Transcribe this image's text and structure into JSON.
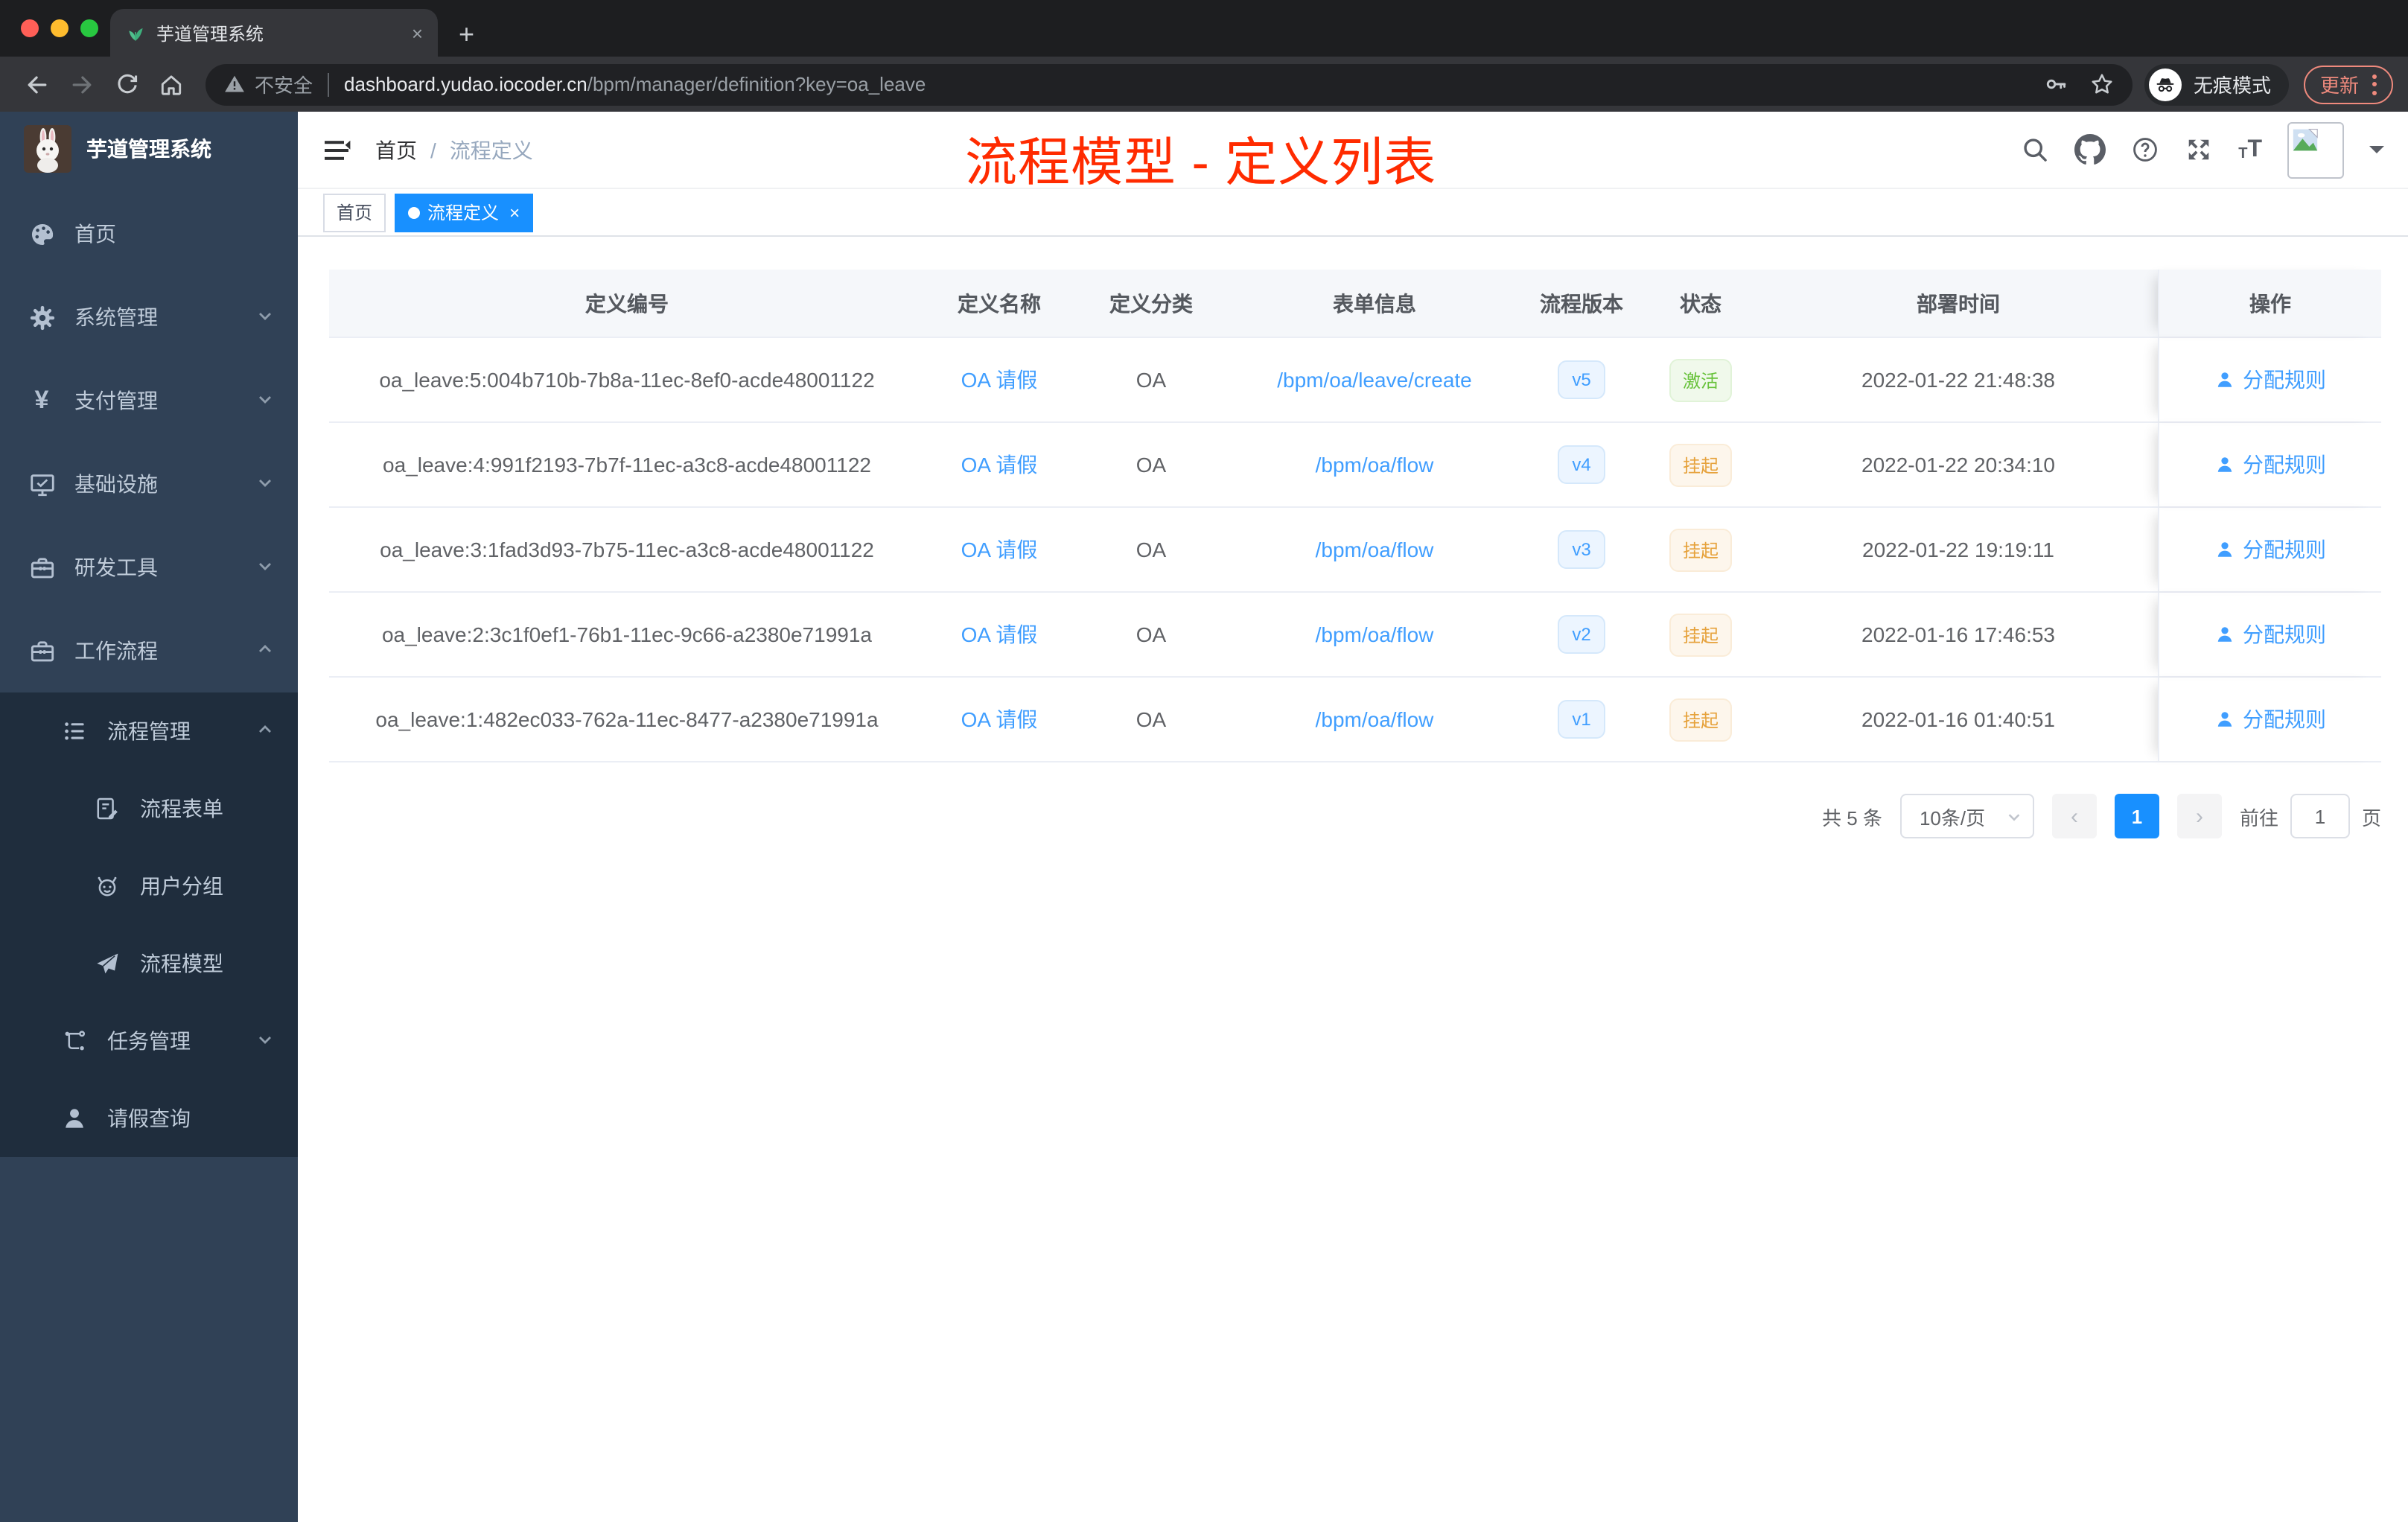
{
  "colors": {
    "primary": "#1890ff",
    "link": "#409eff",
    "success": "#67c23a",
    "warning": "#e6a23c",
    "overlay": "#ff2b00",
    "sidebar_bg": "#304156",
    "submenu_bg": "#1f2d3d"
  },
  "browser": {
    "tab_title": "芋道管理系统",
    "close_glyph": "×",
    "newtab_glyph": "+",
    "warning_label": "不安全",
    "url_host": "dashboard.yudao.iocoder.cn",
    "url_path": "/bpm/manager/definition?key=oa_leave",
    "incognito_label": "无痕模式",
    "update_label": "更新"
  },
  "sidebar": {
    "app_title": "芋道管理系统",
    "items": [
      {
        "label": "首页"
      },
      {
        "label": "系统管理"
      },
      {
        "label": "支付管理"
      },
      {
        "label": "基础设施"
      },
      {
        "label": "研发工具"
      },
      {
        "label": "工作流程"
      },
      {
        "label": "流程管理"
      },
      {
        "label": "流程表单"
      },
      {
        "label": "用户分组"
      },
      {
        "label": "流程模型"
      },
      {
        "label": "任务管理"
      },
      {
        "label": "请假查询"
      }
    ]
  },
  "navbar": {
    "breadcrumb_home": "首页",
    "breadcrumb_sep": "/",
    "breadcrumb_current": "流程定义"
  },
  "tags": {
    "home": "首页",
    "active": "流程定义",
    "close_glyph": "×"
  },
  "overlay_title": "流程模型 - 定义列表",
  "table": {
    "columns": [
      "定义编号",
      "定义名称",
      "定义分类",
      "表单信息",
      "流程版本",
      "状态",
      "部署时间",
      "操作"
    ],
    "rows": [
      {
        "id": "oa_leave:5:004b710b-7b8a-11ec-8ef0-acde48001122",
        "name": "OA 请假",
        "category": "OA",
        "form": "/bpm/oa/leave/create",
        "version": "v5",
        "status": "激活",
        "time": "2022-01-22 21:48:38",
        "action": "分配规则"
      },
      {
        "id": "oa_leave:4:991f2193-7b7f-11ec-a3c8-acde48001122",
        "name": "OA 请假",
        "category": "OA",
        "form": "/bpm/oa/flow",
        "version": "v4",
        "status": "挂起",
        "time": "2022-01-22 20:34:10",
        "action": "分配规则"
      },
      {
        "id": "oa_leave:3:1fad3d93-7b75-11ec-a3c8-acde48001122",
        "name": "OA 请假",
        "category": "OA",
        "form": "/bpm/oa/flow",
        "version": "v3",
        "status": "挂起",
        "time": "2022-01-22 19:19:11",
        "action": "分配规则"
      },
      {
        "id": "oa_leave:2:3c1f0ef1-76b1-11ec-9c66-a2380e71991a",
        "name": "OA 请假",
        "category": "OA",
        "form": "/bpm/oa/flow",
        "version": "v2",
        "status": "挂起",
        "time": "2022-01-16 17:46:53",
        "action": "分配规则"
      },
      {
        "id": "oa_leave:1:482ec033-762a-11ec-8477-a2380e71991a",
        "name": "OA 请假",
        "category": "OA",
        "form": "/bpm/oa/flow",
        "version": "v1",
        "status": "挂起",
        "time": "2022-01-16 01:40:51",
        "action": "分配规则"
      }
    ]
  },
  "pagination": {
    "total": "共 5 条",
    "page_size": "10条/页",
    "prev_glyph": "‹",
    "page": "1",
    "next_glyph": "›",
    "goto_label": "前往",
    "goto_value": "1",
    "unit_label": "页"
  },
  "glyphs": {
    "yen": "¥",
    "t_small": "T",
    "t_big": "T"
  }
}
